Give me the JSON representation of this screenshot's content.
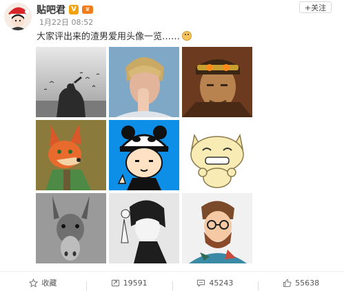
{
  "post": {
    "author": "贴吧君",
    "verified_badge": "V",
    "time": "1月22日 08:52",
    "follow_label": "+关注",
    "text": "大家评出来的渣男爱用头像一览……",
    "emoji_icon": "shy-face-emoji-icon",
    "images": [
      {
        "name": "silhouette-birds-photo"
      },
      {
        "name": "blond-man-photo"
      },
      {
        "name": "monkey-king-photo"
      },
      {
        "name": "cartoon-fox-image"
      },
      {
        "name": "panda-hat-boy-cartoon"
      },
      {
        "name": "smiling-cat-cartoon"
      },
      {
        "name": "donkey-photo"
      },
      {
        "name": "anime-boy-sketch"
      },
      {
        "name": "bearded-man-illustration"
      }
    ]
  },
  "actions": {
    "favorite_label": "收藏",
    "repost_count": "19591",
    "comment_count": "45243",
    "like_count": "55638"
  },
  "colors": {
    "verified_badge": "#f2a20a",
    "accent_orange": "#f07d1a"
  }
}
